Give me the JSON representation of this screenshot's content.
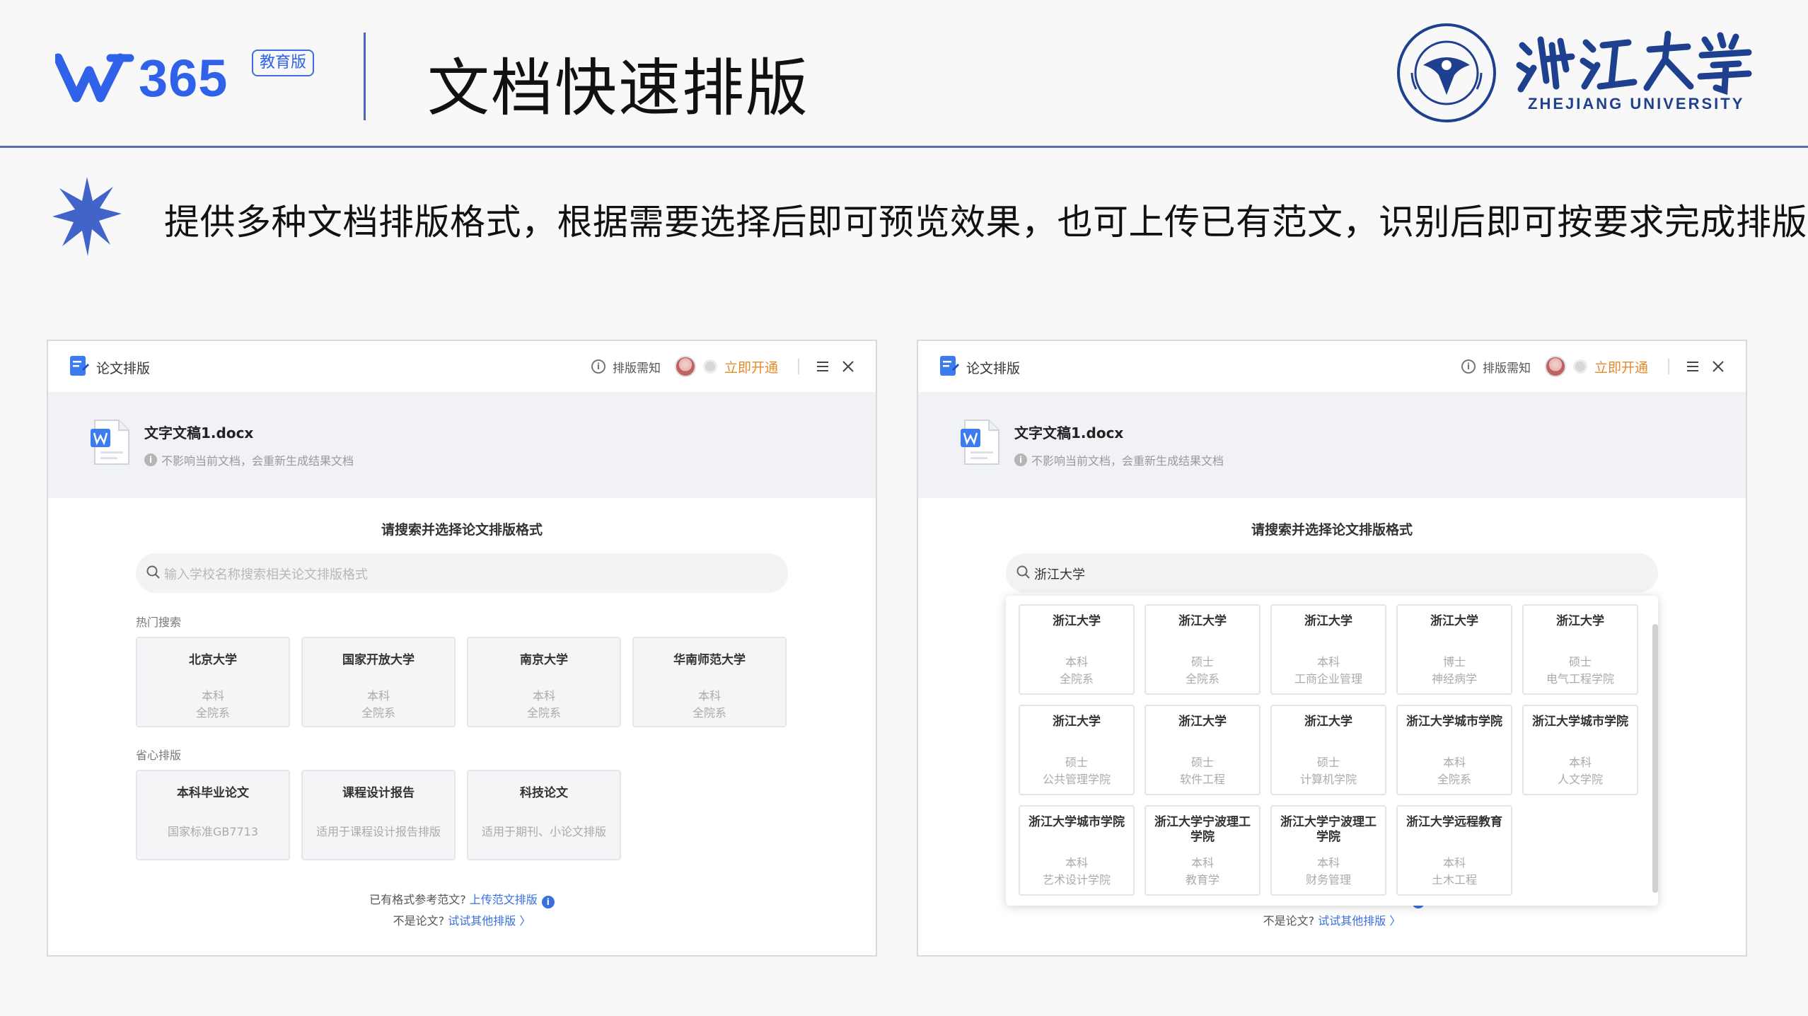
{
  "header": {
    "brand_number": "365",
    "edu_badge": "教育版",
    "title": "文档快速排版",
    "university_en": "ZHEJIANG UNIVERSITY",
    "rule_color": "#5a6fb0"
  },
  "subtitle": "提供多种文档排版格式，根据需要选择后即可预览效果，也可上传已有范文，识别后即可按要求完成排版",
  "panel": {
    "app_title": "论文排版",
    "notice": "排版需知",
    "open_now": "立即开通",
    "file_name": "文字文稿1.docx",
    "file_note": "不影响当前文档，会重新生成结果文档",
    "prompt": "请搜索并选择论文排版格式",
    "footer_line1_prefix": "已有格式参考范文?",
    "footer_line1_link": "上传范文排版",
    "footer_line2_prefix": "不是论文?",
    "footer_line2_link": "试试其他排版 〉"
  },
  "left_panel": {
    "search_placeholder": "输入学校名称搜索相关论文排版格式",
    "hot_label": "热门搜索",
    "hot_cards": [
      {
        "name": "北京大学",
        "degree": "本科",
        "dept": "全院系"
      },
      {
        "name": "国家开放大学",
        "degree": "本科",
        "dept": "全院系"
      },
      {
        "name": "南京大学",
        "degree": "本科",
        "dept": "全院系"
      },
      {
        "name": "华南师范大学",
        "degree": "本科",
        "dept": "全院系"
      }
    ],
    "easy_label": "省心排版",
    "easy_cards": [
      {
        "name": "本科毕业论文",
        "desc": "国家标准GB7713"
      },
      {
        "name": "课程设计报告",
        "desc": "适用于课程设计报告排版"
      },
      {
        "name": "科技论文",
        "desc": "适用于期刊、小论文排版"
      }
    ]
  },
  "right_panel": {
    "search_value": "浙江大学",
    "results": [
      {
        "name": "浙江大学",
        "degree": "本科",
        "dept": "全院系"
      },
      {
        "name": "浙江大学",
        "degree": "硕士",
        "dept": "全院系"
      },
      {
        "name": "浙江大学",
        "degree": "本科",
        "dept": "工商企业管理"
      },
      {
        "name": "浙江大学",
        "degree": "博士",
        "dept": "神经病学"
      },
      {
        "name": "浙江大学",
        "degree": "硕士",
        "dept": "电气工程学院"
      },
      {
        "name": "浙江大学",
        "degree": "硕士",
        "dept": "公共管理学院"
      },
      {
        "name": "浙江大学",
        "degree": "硕士",
        "dept": "软件工程"
      },
      {
        "name": "浙江大学",
        "degree": "硕士",
        "dept": "计算机学院"
      },
      {
        "name": "浙江大学城市学院",
        "degree": "本科",
        "dept": "全院系"
      },
      {
        "name": "浙江大学城市学院",
        "degree": "本科",
        "dept": "人文学院"
      },
      {
        "name": "浙江大学城市学院",
        "degree": "本科",
        "dept": "艺术设计学院"
      },
      {
        "name": "浙江大学宁波理工学院",
        "degree": "本科",
        "dept": "教育学"
      },
      {
        "name": "浙江大学宁波理工学院",
        "degree": "本科",
        "dept": "财务管理"
      },
      {
        "name": "浙江大学远程教育",
        "degree": "本科",
        "dept": "土木工程"
      }
    ]
  },
  "colors": {
    "brand_blue": "#2f62e8",
    "link_blue": "#3b6fe0",
    "accent_orange": "#e38a2b",
    "zju_blue": "#1f3f8f"
  }
}
